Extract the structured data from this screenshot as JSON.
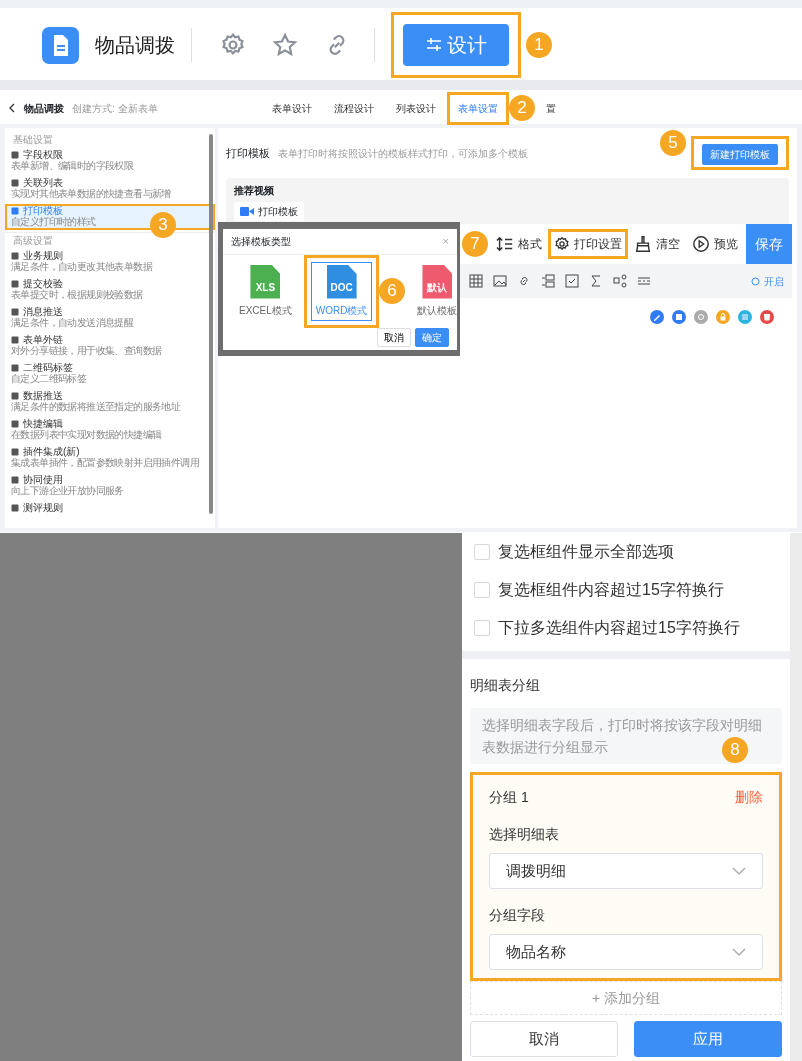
{
  "top_bar": {
    "title": "物品调拨",
    "design_button": "设计",
    "design_highlighted": true,
    "callout": "1"
  },
  "app_header": {
    "title": "物品调拨",
    "created": "创建方式: 全新表单",
    "callout": "2",
    "tabs": [
      {
        "label": "表单设计",
        "selected": false,
        "highlighted": false
      },
      {
        "label": "流程设计",
        "selected": false,
        "highlighted": false
      },
      {
        "label": "列表设计",
        "selected": false,
        "highlighted": false
      },
      {
        "label": "表单设置",
        "selected": true,
        "highlighted": true
      },
      {
        "label": "置",
        "selected": false,
        "highlighted": false
      }
    ]
  },
  "sidebar": {
    "callout": "3",
    "sections": [
      {
        "heading": "基础设置",
        "items": [
          {
            "title": "字段权限",
            "description": "表单新增、编辑时的字段权限",
            "selected": false,
            "highlighted": false
          },
          {
            "title": "关联列表",
            "description": "实现对其他表单数据的快捷查看与新增",
            "selected": false,
            "highlighted": false
          },
          {
            "title": "打印模板",
            "description": "自定义打印时的样式",
            "selected": true,
            "highlighted": true
          }
        ]
      },
      {
        "heading": "高级设置",
        "items": [
          {
            "title": "业务规则",
            "description": "满足条件，自动更改其他表单数据",
            "selected": false,
            "highlighted": false
          },
          {
            "title": "提交校验",
            "description": "表单提交时，根据规则校验数据",
            "selected": false,
            "highlighted": false
          },
          {
            "title": "消息推送",
            "description": "满足条件，自动发送消息提醒",
            "selected": false,
            "highlighted": false
          },
          {
            "title": "表单外链",
            "description": "对外分享链接，用于收集、查询数据",
            "selected": false,
            "highlighted": false
          },
          {
            "title": "二维码标签",
            "description": "自定义二维码标签",
            "selected": false,
            "highlighted": false
          },
          {
            "title": "数据推送",
            "description": "满足条件的数据将推送至指定的服务地址",
            "selected": false,
            "highlighted": false
          },
          {
            "title": "快捷编辑",
            "description": "在数据列表中实现对数据的快捷编辑",
            "selected": false,
            "highlighted": false
          },
          {
            "title": "插件集成(新)",
            "description": "集成表单插件，配置参数映射并启用插件调用",
            "selected": false,
            "highlighted": false
          },
          {
            "title": "协同使用",
            "description": "向上下游企业开放协同服务",
            "selected": false,
            "highlighted": false
          },
          {
            "title": "测评规则",
            "selected": false,
            "highlighted": false
          }
        ]
      }
    ]
  },
  "print_template": {
    "title": "打印模板",
    "description": "表单打印时将按照设计的模板样式打印，可添加多个模板",
    "new_button": "新建打印模板",
    "new_highlighted": true,
    "callout": "5"
  },
  "recommended_video": {
    "heading": "推荐视频",
    "chip": "打印模板"
  },
  "template_dialog": {
    "title": "选择模板类型",
    "close": "×",
    "callout": "6",
    "options": [
      {
        "kind": "xls",
        "icon_text": "XLS",
        "label": "EXCEL模式",
        "selected": false,
        "highlighted": false
      },
      {
        "kind": "doc",
        "icon_text": "DOC",
        "label": "WORD模式",
        "selected": true,
        "highlighted": true
      },
      {
        "kind": "default",
        "icon_text": "默认",
        "label": "默认模板",
        "selected": false,
        "highlighted": false
      }
    ],
    "cancel": "取消",
    "confirm": "确定"
  },
  "toolbar": {
    "callout": "7",
    "items": [
      {
        "kind": "format",
        "label": "格式",
        "highlighted": false
      },
      {
        "kind": "print",
        "label": "打印设置",
        "highlighted": true
      },
      {
        "kind": "clear",
        "label": "清空",
        "highlighted": false
      },
      {
        "kind": "preview",
        "label": "预览",
        "highlighted": false
      }
    ],
    "save": "保存"
  },
  "format_bar": {
    "toggle": "开启"
  },
  "panel": {
    "options": [
      {
        "label": "复选框组件显示全部选项",
        "checked": false
      },
      {
        "label": "复选框组件内容超过15字符换行",
        "checked": false
      },
      {
        "label": "下拉多选组件内容超过15字符换行",
        "checked": false
      }
    ],
    "group_heading": "明细表分组",
    "hint": "选择明细表字段后，打印时将按该字段对明细表数据进行分组显示",
    "callout": "8",
    "groups": [
      {
        "title": "分组 1",
        "delete": "删除",
        "highlighted": true,
        "table_label": "选择明细表",
        "table_value": "调拨明细",
        "field_label": "分组字段",
        "field_value": "物品名称"
      }
    ],
    "add_group": "+ 添加分组",
    "cancel": "取消",
    "apply": "应用"
  }
}
